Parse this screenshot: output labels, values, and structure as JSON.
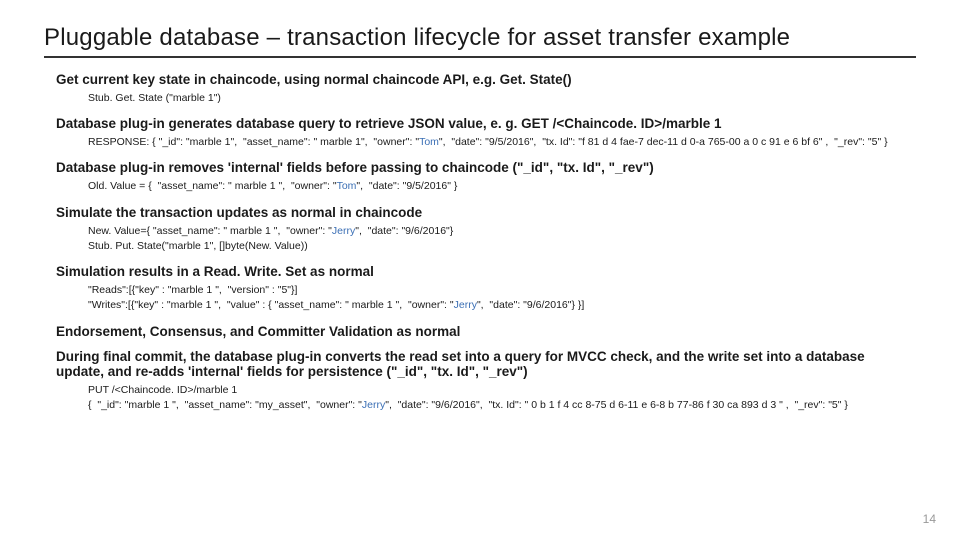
{
  "title": "Pluggable database – transaction lifecycle for asset transfer example",
  "sections": [
    {
      "heading": "Get current key state in chaincode, using normal chaincode API, e.g. Get. State()",
      "code_lines": [
        [
          {
            "t": "Stub. Get. State (\"marble 1\")"
          }
        ]
      ]
    },
    {
      "heading": "Database plug-in generates database query to retrieve JSON value,  e. g. GET /<Chaincode. ID>/marble 1",
      "code_lines": [
        [
          {
            "t": "RESPONSE: { \"_id\": \"marble 1\",  \"asset_name\": \" marble 1\",  \"owner\": \""
          },
          {
            "t": "Tom",
            "c": "t-blue"
          },
          {
            "t": "\",  \"date\": \"9/5/2016\",  \"tx. Id\": \"f 81 d 4 fae-7 dec-11 d 0-a 765-00 a 0 c 91 e 6 bf 6\" ,  \"_rev\": \"5\" }"
          }
        ]
      ]
    },
    {
      "heading": "Database plug-in removes 'internal' fields before passing to chaincode (\"_id\", \"tx. Id\", \"_rev\")",
      "code_lines": [
        [
          {
            "t": "Old. Value = {  \"asset_name\": \" marble 1 \",  \"owner\": \""
          },
          {
            "t": "Tom",
            "c": "t-blue"
          },
          {
            "t": "\",  \"date\": \"9/5/2016\" }"
          }
        ]
      ]
    },
    {
      "heading": "Simulate the transaction updates as normal in chaincode",
      "code_lines": [
        [
          {
            "t": "New. Value={ \"asset_name\": \" marble 1 \",  \"owner\": \""
          },
          {
            "t": "Jerry",
            "c": "t-blue"
          },
          {
            "t": "\",  \"date\": \"9/6/2016\"}"
          }
        ],
        [
          {
            "t": "Stub. Put. State(\"marble 1\", []byte(New. Value))"
          }
        ]
      ]
    },
    {
      "heading": "Simulation results in a Read. Write. Set as normal",
      "code_lines": [
        [
          {
            "t": "\"Reads\":[{\"key\" : \"marble 1 \",  \"version\" : \"5\"}]"
          }
        ],
        [
          {
            "t": "\"Writes\":[{\"key\" : \"marble 1 \",  \"value\" : { \"asset_name\": \" marble 1 \",  \"owner\": \""
          },
          {
            "t": "Jerry",
            "c": "t-blue"
          },
          {
            "t": "\",  \"date\": \"9/6/2016\"} }]"
          }
        ]
      ]
    },
    {
      "heading": "Endorsement, Consensus, and Committer Validation as normal",
      "code_lines": []
    },
    {
      "heading": "During final commit, the database plug-in converts the read set into a query for MVCC check, and the write set into a database update, and re-adds 'internal' fields for persistence (\"_id\", \"tx. Id\", \"_rev\")",
      "code_lines": [
        [
          {
            "t": "PUT /<Chaincode. ID>/marble 1"
          }
        ],
        [
          {
            "t": "{  \"_id\": \"marble 1 \",  \"asset_name\": \"my_asset\",  \"owner\": \""
          },
          {
            "t": "Jerry",
            "c": "t-blue"
          },
          {
            "t": "\",  \"date\": \"9/6/2016\",  \"tx. Id\": \" 0 b 1 f 4 cc 8-75 d 6-11 e 6-8 b 77-86 f 30 ca 893 d 3 \" ,  \"_rev\": \"5\" }"
          }
        ]
      ]
    }
  ],
  "page_number": "14"
}
